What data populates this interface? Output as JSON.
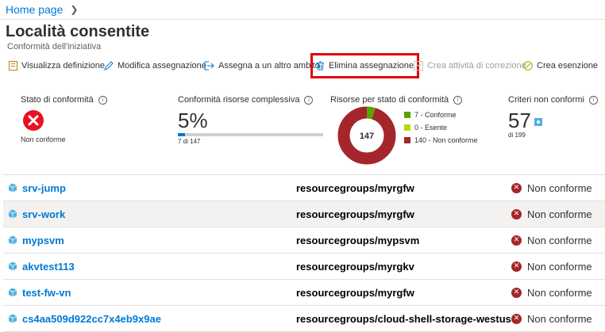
{
  "breadcrumb": {
    "home": "Home page"
  },
  "page": {
    "title": "Località consentite",
    "subtitle": "Conformità dell'iniziativa"
  },
  "toolbar": {
    "view_definition": "Visualizza definizione",
    "edit_assignment": "Modifica assegnazione",
    "assign_scope": "Assegna a un altro ambito",
    "delete_assignment": "Elimina assegnazione",
    "create_remediation": "Crea attività di correzione",
    "create_exemption": "Crea esenzione"
  },
  "stats": {
    "compliance_state": {
      "title": "Stato di conformità",
      "value": "Non conforme"
    },
    "overall_compliance": {
      "title": "Conformità risorse complessiva",
      "percent": "5%",
      "detail": "7 di 147",
      "fraction": 0.048
    },
    "resources_by_state": {
      "title": "Risorse per stato di conformità",
      "total": "147",
      "legend": [
        {
          "label": "7 - Conforme",
          "value": 7,
          "color": "#57a300"
        },
        {
          "label": "0 - Esente",
          "value": 0,
          "color": "#bad80a"
        },
        {
          "label": "140 - Non conforme",
          "value": 140,
          "color": "#a4262c"
        }
      ]
    },
    "noncompliant_policies": {
      "title": "Criteri non conformi",
      "value": "57",
      "detail": "di 199"
    }
  },
  "resources": [
    {
      "name": "srv-jump",
      "group": "resourcegroups/myrgfw",
      "status": "Non conforme"
    },
    {
      "name": "srv-work",
      "group": "resourcegroups/myrgfw",
      "status": "Non conforme"
    },
    {
      "name": "mypsvm",
      "group": "resourcegroups/mypsvm",
      "status": "Non conforme"
    },
    {
      "name": "akvtest113",
      "group": "resourcegroups/myrgkv",
      "status": "Non conforme"
    },
    {
      "name": "test-fw-vn",
      "group": "resourcegroups/myrgfw",
      "status": "Non conforme"
    },
    {
      "name": "cs4aa509d922cc7x4eb9x9ae",
      "group": "resourcegroups/cloud-shell-storage-westus",
      "status": "Non conforme"
    }
  ]
}
